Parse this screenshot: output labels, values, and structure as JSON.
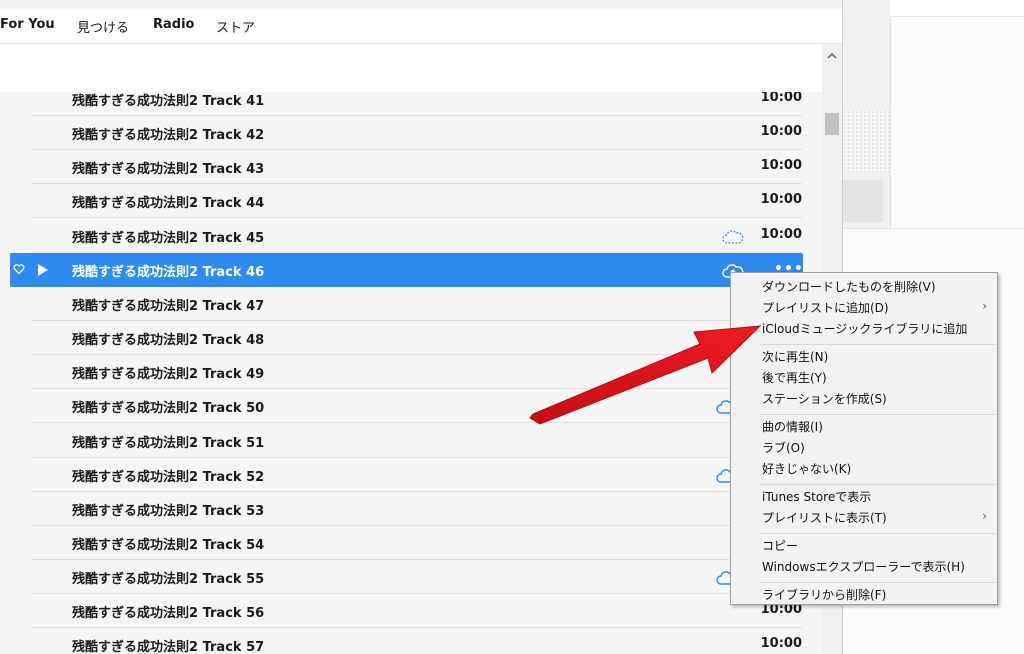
{
  "nav": {
    "items": [
      "For You",
      "見つける",
      "Radio",
      "ストア"
    ]
  },
  "tracks": [
    {
      "title": "残酷すぎる成功法則2 Track 41",
      "time": "10:00",
      "cloud": false
    },
    {
      "title": "残酷すぎる成功法則2 Track 42",
      "time": "10:00",
      "cloud": false
    },
    {
      "title": "残酷すぎる成功法則2 Track 43",
      "time": "10:00",
      "cloud": false
    },
    {
      "title": "残酷すぎる成功法則2 Track 44",
      "time": "10:00",
      "cloud": false
    },
    {
      "title": "残酷すぎる成功法則2 Track 45",
      "time": "10:00",
      "cloud": "dashed-cloud-icon"
    },
    {
      "title": "残酷すぎる成功法則2 Track 46",
      "time": "",
      "cloud": "cloud-upload-icon",
      "selected": true,
      "more": "•••"
    },
    {
      "title": "残酷すぎる成功法則2 Track 47",
      "time": "",
      "cloud": false
    },
    {
      "title": "残酷すぎる成功法則2 Track 48",
      "time": "",
      "cloud": false
    },
    {
      "title": "残酷すぎる成功法則2 Track 49",
      "time": "",
      "cloud": false
    },
    {
      "title": "残酷すぎる成功法則2 Track 50",
      "time": "",
      "cloud": "cloud-icon"
    },
    {
      "title": "残酷すぎる成功法則2 Track 51",
      "time": "",
      "cloud": false
    },
    {
      "title": "残酷すぎる成功法則2 Track 52",
      "time": "",
      "cloud": "cloud-icon"
    },
    {
      "title": "残酷すぎる成功法則2 Track 53",
      "time": "",
      "cloud": false
    },
    {
      "title": "残酷すぎる成功法則2 Track 54",
      "time": "",
      "cloud": false
    },
    {
      "title": "残酷すぎる成功法則2 Track 55",
      "time": "",
      "cloud": "cloud-icon"
    },
    {
      "title": "残酷すぎる成功法則2 Track 56",
      "time": "10:00",
      "cloud": false
    },
    {
      "title": "残酷すぎる成功法則2 Track 57",
      "time": "10:00",
      "cloud": false
    }
  ],
  "context_menu": {
    "groups": [
      [
        {
          "label": "ダウンロードしたものを削除(V)"
        },
        {
          "label": "プレイリストに追加(D)",
          "submenu": "›"
        },
        {
          "label": "iCloudミュージックライブラリに追加"
        }
      ],
      [
        {
          "label": "次に再生(N)"
        },
        {
          "label": "後で再生(Y)"
        },
        {
          "label": "ステーションを作成(S)"
        }
      ],
      [
        {
          "label": "曲の情報(I)"
        },
        {
          "label": "ラブ(O)"
        },
        {
          "label": "好きじゃない(K)"
        }
      ],
      [
        {
          "label": "iTunes Storeで表示"
        },
        {
          "label": "プレイリストに表示(T)",
          "submenu": "›"
        }
      ],
      [
        {
          "label": "コピー"
        },
        {
          "label": "Windowsエクスプローラーで表示(H)"
        }
      ],
      [
        {
          "label": "ライブラリから削除(F)"
        }
      ]
    ]
  },
  "colors": {
    "selection": "#2e8cf0",
    "cloud": "#2e8cf0",
    "annotation_arrow": "#e8141b"
  }
}
